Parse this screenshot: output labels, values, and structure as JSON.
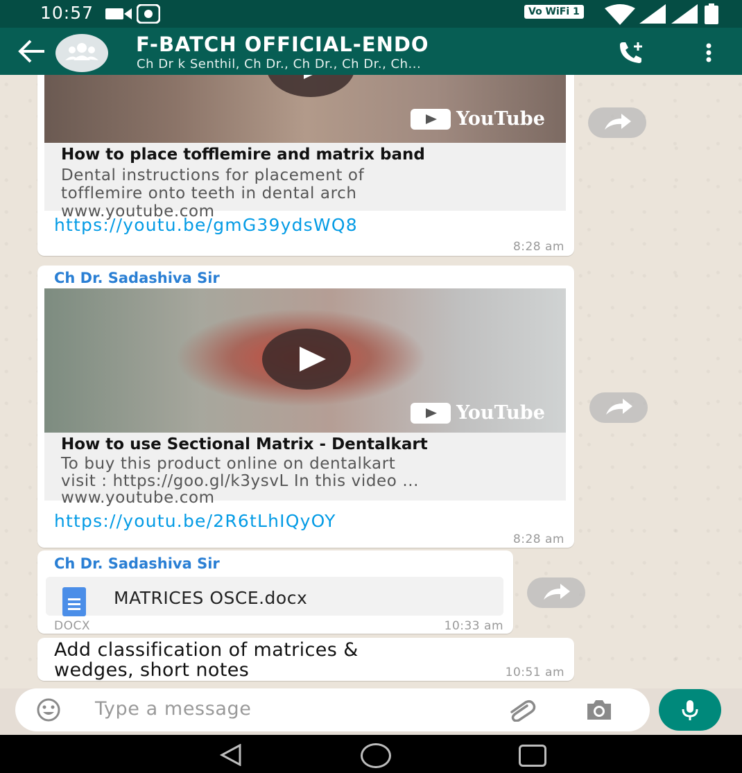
{
  "status_bar": {
    "time": "10:57",
    "network_badge": "Vo WiFi 1",
    "icons": [
      "video-call-icon",
      "notification-icon",
      "wifi-icon",
      "signal-icon",
      "signal-icon",
      "battery-icon"
    ]
  },
  "header": {
    "title": "F-BATCH OFFICIAL-ENDO",
    "subtitle": "Ch Dr k Senthil, Ch Dr., Ch Dr., Ch Dr., Ch...",
    "icons": [
      "back-arrow-icon",
      "group-avatar-icon",
      "add-call-icon",
      "more-vert-icon"
    ]
  },
  "messages": [
    {
      "type": "link",
      "brand": "YouTube",
      "preview_title": "How to place tofflemire and matrix band",
      "preview_desc": [
        "Dental instructions for placement of",
        "tofflemire onto teeth in dental arch"
      ],
      "preview_domain": "www.youtube.com",
      "url": "https://youtu.be/gmG39ydsWQ8",
      "time": "8:28 am"
    },
    {
      "type": "link",
      "sender": "Ch Dr. Sadashiva Sir",
      "brand": "YouTube",
      "preview_title": "How to use Sectional Matrix - Dentalkart",
      "preview_desc": [
        "To buy this product online on dentalkart",
        "visit : https://goo.gl/k3ysvL In this video ..."
      ],
      "preview_domain": "www.youtube.com",
      "url": "https://youtu.be/2R6tLhIQyOY",
      "time": "8:28 am"
    },
    {
      "type": "document",
      "sender": "Ch Dr. Sadashiva Sir",
      "file_name": "MATRICES OSCE.docx",
      "file_type": "DOCX",
      "time": "10:33 am"
    },
    {
      "type": "text",
      "text_lines": [
        "Add classification of matrices &",
        "wedges, short notes"
      ],
      "time": "10:51 am"
    }
  ],
  "composer": {
    "placeholder": "Type a message",
    "icons": [
      "emoji-icon",
      "attach-icon",
      "camera-icon",
      "mic-icon"
    ]
  },
  "colors": {
    "header": "#075e54",
    "status_bar": "#054d44",
    "accent": "#00897b",
    "link": "#039be5",
    "sender": "#2a7fd4"
  }
}
